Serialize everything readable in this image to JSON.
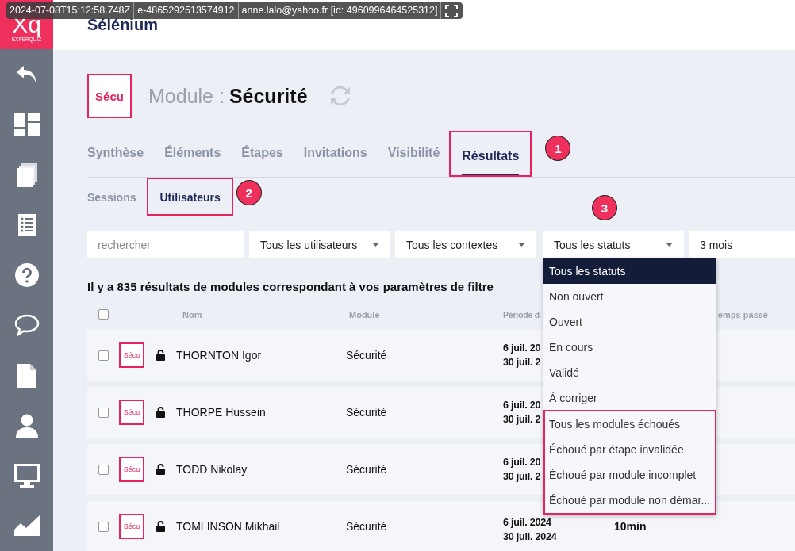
{
  "capture_bar": {
    "timestamp": "2024-07-08T15:12:58.748Z",
    "session": "e-4865292513574912",
    "user": "anne.lalo@yahoo.fr [id: 4960996464525312]"
  },
  "logo": {
    "initials": "Xq",
    "name": "EXPERQUIZ"
  },
  "sidebar": {
    "items": [
      {
        "kind": "back"
      },
      {
        "kind": "dashboard"
      },
      {
        "kind": "pages"
      },
      {
        "kind": "list"
      },
      {
        "kind": "help"
      },
      {
        "kind": "chat"
      },
      {
        "kind": "document"
      },
      {
        "kind": "user"
      },
      {
        "kind": "monitor"
      },
      {
        "kind": "chart"
      }
    ]
  },
  "header": {
    "title": "Sélénium"
  },
  "module": {
    "badge": "Sécu",
    "label": "Module :",
    "name": "Sécurité"
  },
  "tabs": [
    {
      "label": "Synthèse",
      "selected": false
    },
    {
      "label": "Éléments",
      "selected": false
    },
    {
      "label": "Étapes",
      "selected": false
    },
    {
      "label": "Invitations",
      "selected": false
    },
    {
      "label": "Visibilité",
      "selected": false
    },
    {
      "label": "Résultats",
      "selected": true,
      "callout": "1"
    }
  ],
  "subtabs": [
    {
      "label": "Sessions",
      "selected": false
    },
    {
      "label": "Utilisateurs",
      "selected": true,
      "callout": "2"
    }
  ],
  "filters": {
    "search": {
      "placeholder": "rechercher"
    },
    "selects": [
      {
        "value": "Tous les utilisateurs",
        "caret": true,
        "open": false
      },
      {
        "value": "Tous les contextes",
        "caret": true,
        "open": false
      },
      {
        "value": "Tous les statuts",
        "caret": true,
        "open": true,
        "callout": "3"
      },
      {
        "value": "3 mois",
        "caret": false,
        "open": false
      }
    ]
  },
  "status_menu": {
    "groups": [
      {
        "boxed": false,
        "items": [
          {
            "label": "Tous les statuts",
            "selected": true
          },
          {
            "label": "Non ouvert",
            "selected": false
          },
          {
            "label": "Ouvert",
            "selected": false
          },
          {
            "label": "En cours",
            "selected": false
          },
          {
            "label": "Validé",
            "selected": false
          },
          {
            "label": "À corriger",
            "selected": false
          }
        ]
      },
      {
        "boxed": true,
        "items": [
          {
            "label": "Tous les modules échoués",
            "selected": false
          },
          {
            "label": "Échoué par étape invalidée",
            "selected": false
          },
          {
            "label": "Échoué par module incomplet",
            "selected": false
          },
          {
            "label": "Échoué par module non démar...",
            "selected": false
          }
        ]
      }
    ]
  },
  "result_summary": "Il y a 835 résultats de modules correspondant à vos paramètres de filtre",
  "table": {
    "select_all_checked": false,
    "columns": [
      "Nom",
      "Module",
      "Période d",
      "emps passé"
    ],
    "rows": [
      {
        "checked": false,
        "badge": "Sécu",
        "locked": false,
        "name": "THORNTON Igor",
        "module": "Sécurité",
        "start": "6 juil. 20",
        "end": "30 juil. 2"
      },
      {
        "checked": false,
        "badge": "Sécu",
        "locked": false,
        "name": "THORPE Hussein",
        "module": "Sécurité",
        "start": "6 juil. 20",
        "end": "30 juil. 2"
      },
      {
        "checked": false,
        "badge": "Sécu",
        "locked": false,
        "name": "TODD Nikolay",
        "module": "Sécurité",
        "start": "6 juil. 20",
        "end": "30 juil. 2"
      },
      {
        "checked": false,
        "badge": "Sécu",
        "locked": false,
        "name": "TOMLINSON Mikhail",
        "module": "Sécurité",
        "start": "6 juil. 2024",
        "end": "30 juil. 2024",
        "time": "10min"
      }
    ]
  }
}
